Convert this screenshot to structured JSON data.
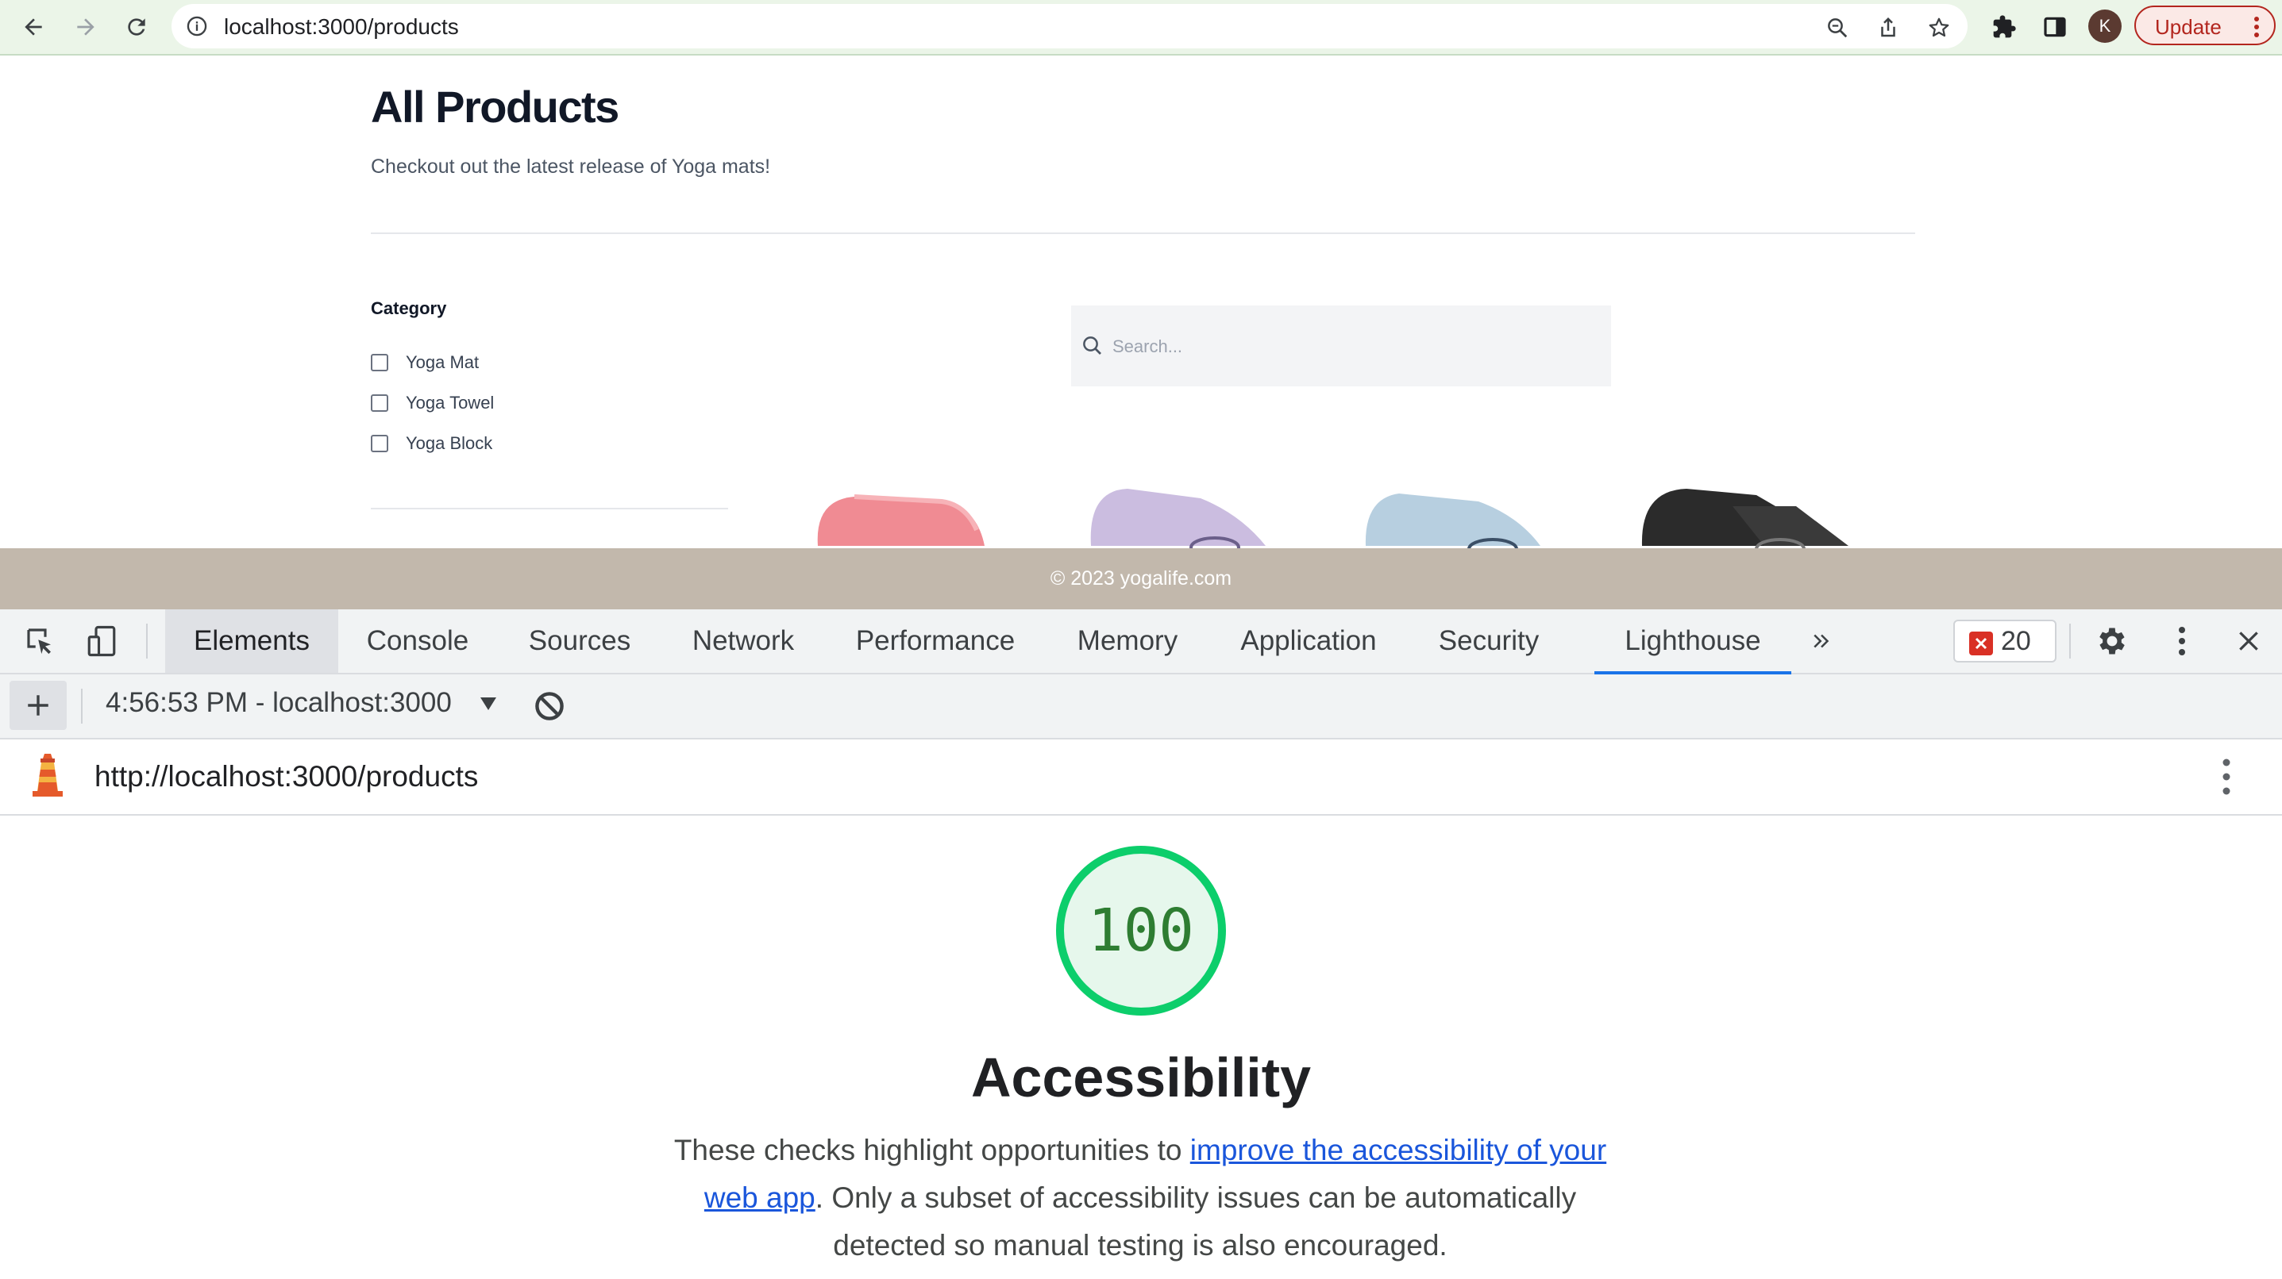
{
  "browser": {
    "url": "localhost:3000/products",
    "profile_initial": "K",
    "update_label": "Update"
  },
  "page": {
    "title": "All Products",
    "subtitle": "Checkout out the latest release of Yoga mats!",
    "category_title": "Category",
    "categories": [
      {
        "label": "Yoga Mat",
        "checked": false
      },
      {
        "label": "Yoga Towel",
        "checked": false
      },
      {
        "label": "Yoga Block",
        "checked": false
      }
    ],
    "search_placeholder": "Search...",
    "products": [
      {
        "color": "#f08b93"
      },
      {
        "color": "#cbbde0"
      },
      {
        "color": "#b7cfe0"
      },
      {
        "color": "#2b2b2b"
      }
    ],
    "footer": "© 2023 yogalife.com"
  },
  "devtools": {
    "tabs": [
      "Elements",
      "Console",
      "Sources",
      "Network",
      "Performance",
      "Memory",
      "Application",
      "Security",
      "Lighthouse"
    ],
    "selected_tab": "Elements",
    "active_tab": "Lighthouse",
    "error_count": "20",
    "run_label": "4:56:53 PM - localhost:3000"
  },
  "lighthouse": {
    "url": "http://localhost:3000/products",
    "score": "100",
    "score_fraction": 1.0,
    "category": "Accessibility",
    "desc_before": "These checks highlight opportunities to ",
    "desc_link": "improve the accessibility of your web app",
    "desc_after": ". Only a subset of accessibility issues can be automatically detected so manual testing is also encouraged."
  },
  "colors": {
    "footer_bg": "#c2b8ac",
    "score_green": "#0cce6b",
    "link": "#1a56db",
    "tab_underline": "#1a73e8",
    "error_red": "#d93025"
  }
}
